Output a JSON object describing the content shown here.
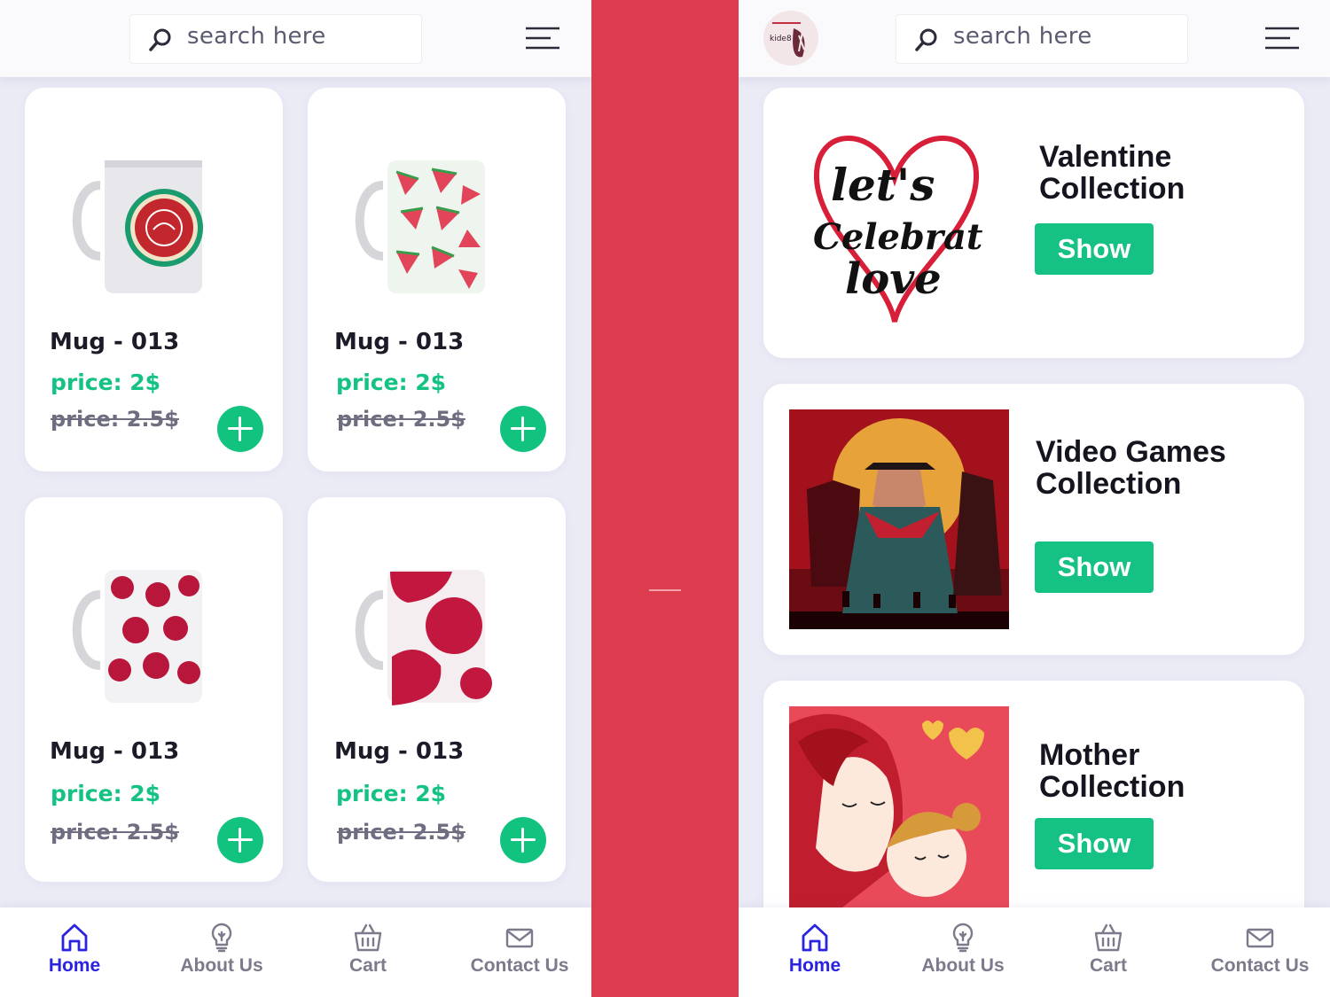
{
  "search": {
    "placeholder": "search here"
  },
  "left_screen": {
    "products": [
      {
        "name": "Mug - 013",
        "price": "price: 2$",
        "old_price": "price: 2.5$",
        "design": "red medallion"
      },
      {
        "name": "Mug - 013",
        "price": "price: 2$",
        "old_price": "price: 2.5$",
        "design": "watermelon"
      },
      {
        "name": "Mug - 013",
        "price": "price: 2$",
        "old_price": "price: 2.5$",
        "design": "pomegranates"
      },
      {
        "name": "Mug - 013",
        "price": "price: 2$",
        "old_price": "price: 2.5$",
        "design": "big pomegranate"
      }
    ]
  },
  "right_screen": {
    "collections": [
      {
        "title_line1": "Valentine",
        "title_line2": "Collection",
        "button": "Show",
        "image": "let's celebrate love heart"
      },
      {
        "title_line1": "Video Games",
        "title_line2": "Collection",
        "button": "Show",
        "image": "western game poster"
      },
      {
        "title_line1": "Mother",
        "title_line2": "Collection",
        "button": "Show",
        "image": "mother and daughter illustration"
      }
    ]
  },
  "nav": {
    "items": [
      {
        "label": "Home",
        "icon": "home-icon",
        "active": true
      },
      {
        "label": "About Us",
        "icon": "lightbulb-icon",
        "active": false
      },
      {
        "label": "Cart",
        "icon": "basket-icon",
        "active": false
      },
      {
        "label": "Contact Us",
        "icon": "mail-icon",
        "active": false
      }
    ]
  },
  "colors": {
    "accent_green": "#12c27f",
    "active_blue": "#2a23e0",
    "divider_red": "#dc3c4e"
  }
}
